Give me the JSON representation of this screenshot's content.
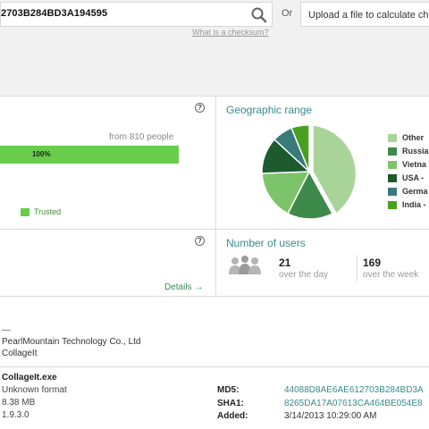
{
  "search": {
    "value": "2703B284BD3A194595",
    "or_label": "Or",
    "upload_text": "Upload a file to calculate che",
    "checksum_link": "What is a checksum?"
  },
  "trust": {
    "help": "?",
    "from_people": "from 810 people",
    "bar_label": "100%",
    "bar_percent": 100,
    "legend_label": "Trusted",
    "color": "#67cd4a"
  },
  "geo": {
    "help": "?",
    "title": "Geographic range",
    "legend": [
      {
        "label": "Other",
        "color": "#a8d49a"
      },
      {
        "label": "Russia",
        "color": "#3d8a4a"
      },
      {
        "label": "Vietna",
        "color": "#7cc46a"
      },
      {
        "label": "USA -",
        "color": "#1d5a2e"
      },
      {
        "label": "Germa",
        "color": "#3a7a7a"
      },
      {
        "label": "India -",
        "color": "#48a020"
      }
    ]
  },
  "users": {
    "help": "?",
    "title": "Number of users",
    "details_link": "Details →",
    "day_count": "21",
    "day_label": "over the day",
    "week_count": "169",
    "week_label": "over the week"
  },
  "publisher": {
    "dash": "—",
    "company": "PearlMountain Technology Co., Ltd",
    "product": "CollageIt"
  },
  "file": {
    "name": "CollageIt.exe",
    "format": "Unknown format",
    "size": "8.38 MB",
    "version": "1.9.3.0",
    "md5_key": "MD5:",
    "md5_value": "44088D8AE6AE612703B284BD3A",
    "sha1_key": "SHA1:",
    "sha1_value": "8265DA17A07613CA464BE054E8",
    "added_key": "Added:",
    "added_value": "3/14/2013 10:29:00 AM"
  }
}
